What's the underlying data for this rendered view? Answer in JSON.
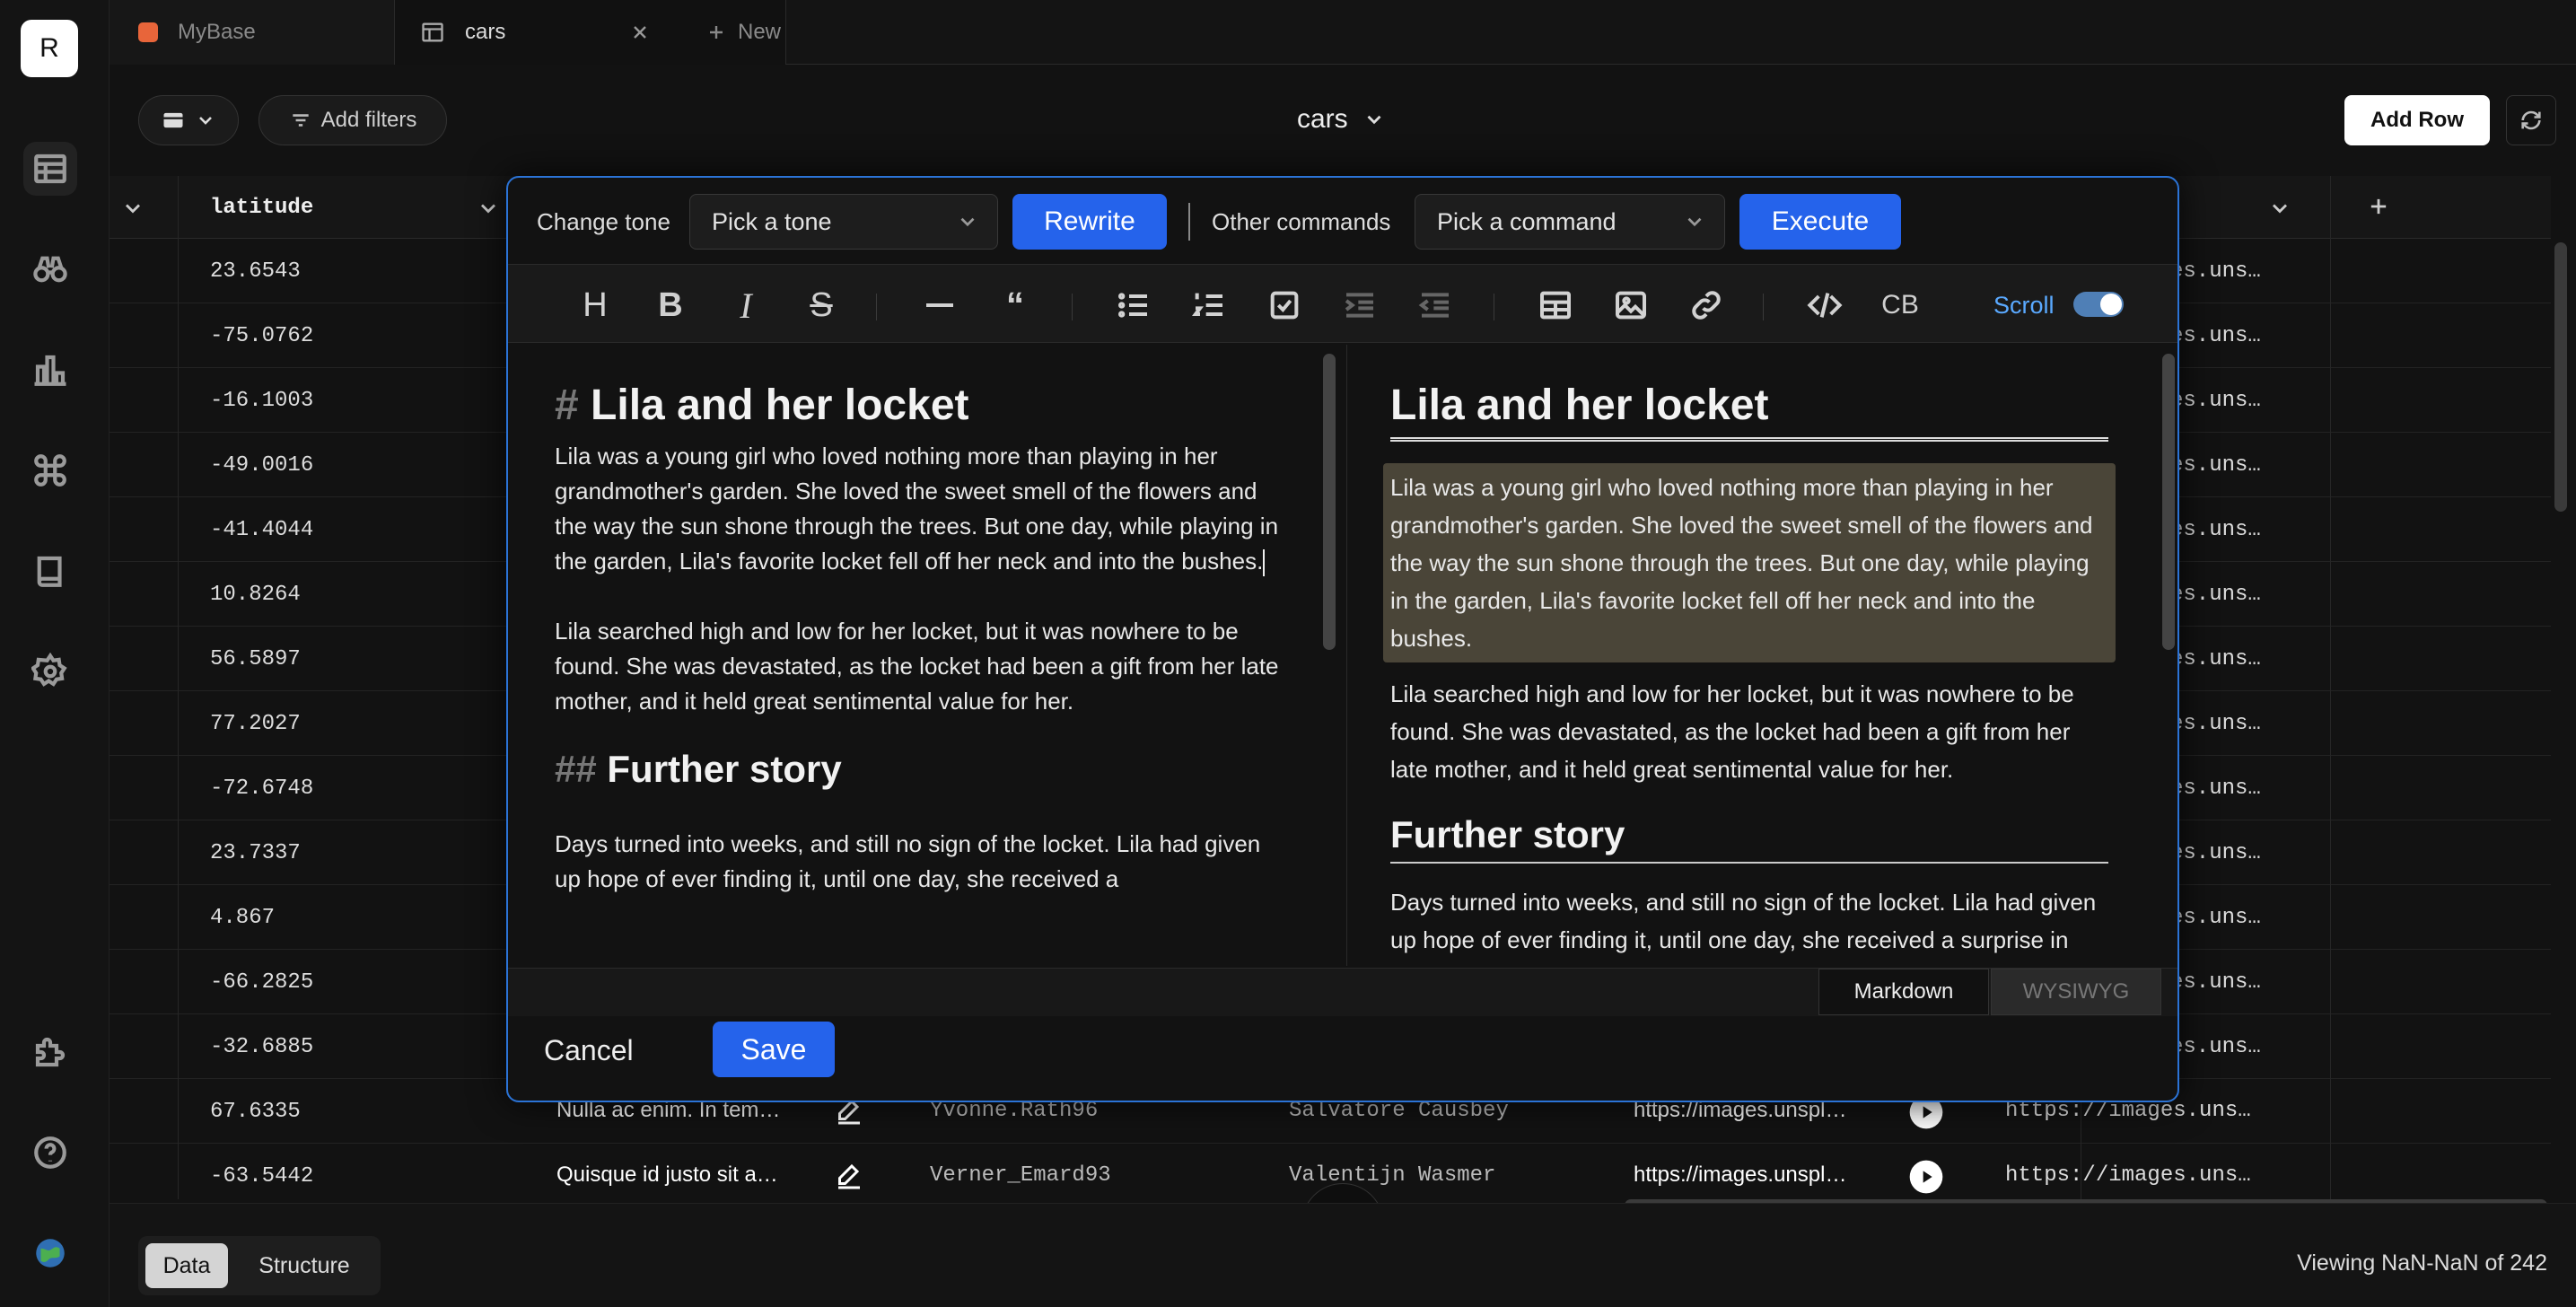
{
  "workspace": {
    "logo_letter": "R"
  },
  "tabs": [
    {
      "label": "MyBase",
      "color": "#e8653a"
    },
    {
      "label": "cars"
    },
    {
      "label": "New"
    }
  ],
  "toolbar": {
    "filters_label": "Add filters",
    "table_title": "cars",
    "add_row_label": "Add Row"
  },
  "grid": {
    "columns": [
      "latitude"
    ],
    "latitude": [
      "23.6543",
      "-75.0762",
      "-16.1003",
      "-49.0016",
      "-41.4044",
      "10.8264",
      "56.5897",
      "77.2027",
      "-72.6748",
      "23.7337",
      "4.867",
      "-66.2825",
      "-32.6885",
      "67.6335",
      "-63.5442"
    ],
    "url_cut": "es.uns…",
    "bottom_rows": [
      {
        "text": "Nulla ac enim. In tem…",
        "user": "Yvonne.Rath96",
        "name": "Salvatore Causbey",
        "url": "https://images.unspl…",
        "url2": "https://images.uns…"
      },
      {
        "text": "Quisque id justo sit a…",
        "user": "Verner_Emard93",
        "name": "Valentijn Wasmer",
        "url": "https://images.unspl…",
        "url2": "https://images.uns…"
      }
    ]
  },
  "footer": {
    "view_data": "Data",
    "view_structure": "Structure",
    "viewing": "Viewing NaN-NaN of 242"
  },
  "editor": {
    "change_tone_label": "Change tone",
    "tone_placeholder": "Pick a tone",
    "rewrite_label": "Rewrite",
    "other_commands_label": "Other commands",
    "command_placeholder": "Pick a command",
    "execute_label": "Execute",
    "scroll_label": "Scroll",
    "scroll_on": true,
    "h1_mark": "#",
    "h2_mark": "##",
    "title": "Lila and her locket",
    "para1": "Lila was a young girl who loved nothing more than playing in her grandmother's garden. She loved the sweet smell of the flowers and the way the sun shone through the trees. But one day, while playing in the garden, Lila's favorite locket fell off her neck and into the bushes.",
    "para2": "Lila searched high and low for her locket, but it was nowhere to be found. She was devastated, as the locket had been a gift from her late mother, and it held great sentimental value for her.",
    "subtitle": "Further story",
    "para3_left": "Days turned into weeks, and still no sign of the locket. Lila had given up hope of ever finding it, until one day, she received a",
    "para3_right": "Days turned into weeks, and still no sign of the locket. Lila had given up hope of ever finding it, until one day, she received a surprise in",
    "mode_markdown": "Markdown",
    "mode_wysiwyg": "WYSIWYG",
    "cancel_label": "Cancel",
    "save_label": "Save",
    "accent": "#2563eb"
  }
}
